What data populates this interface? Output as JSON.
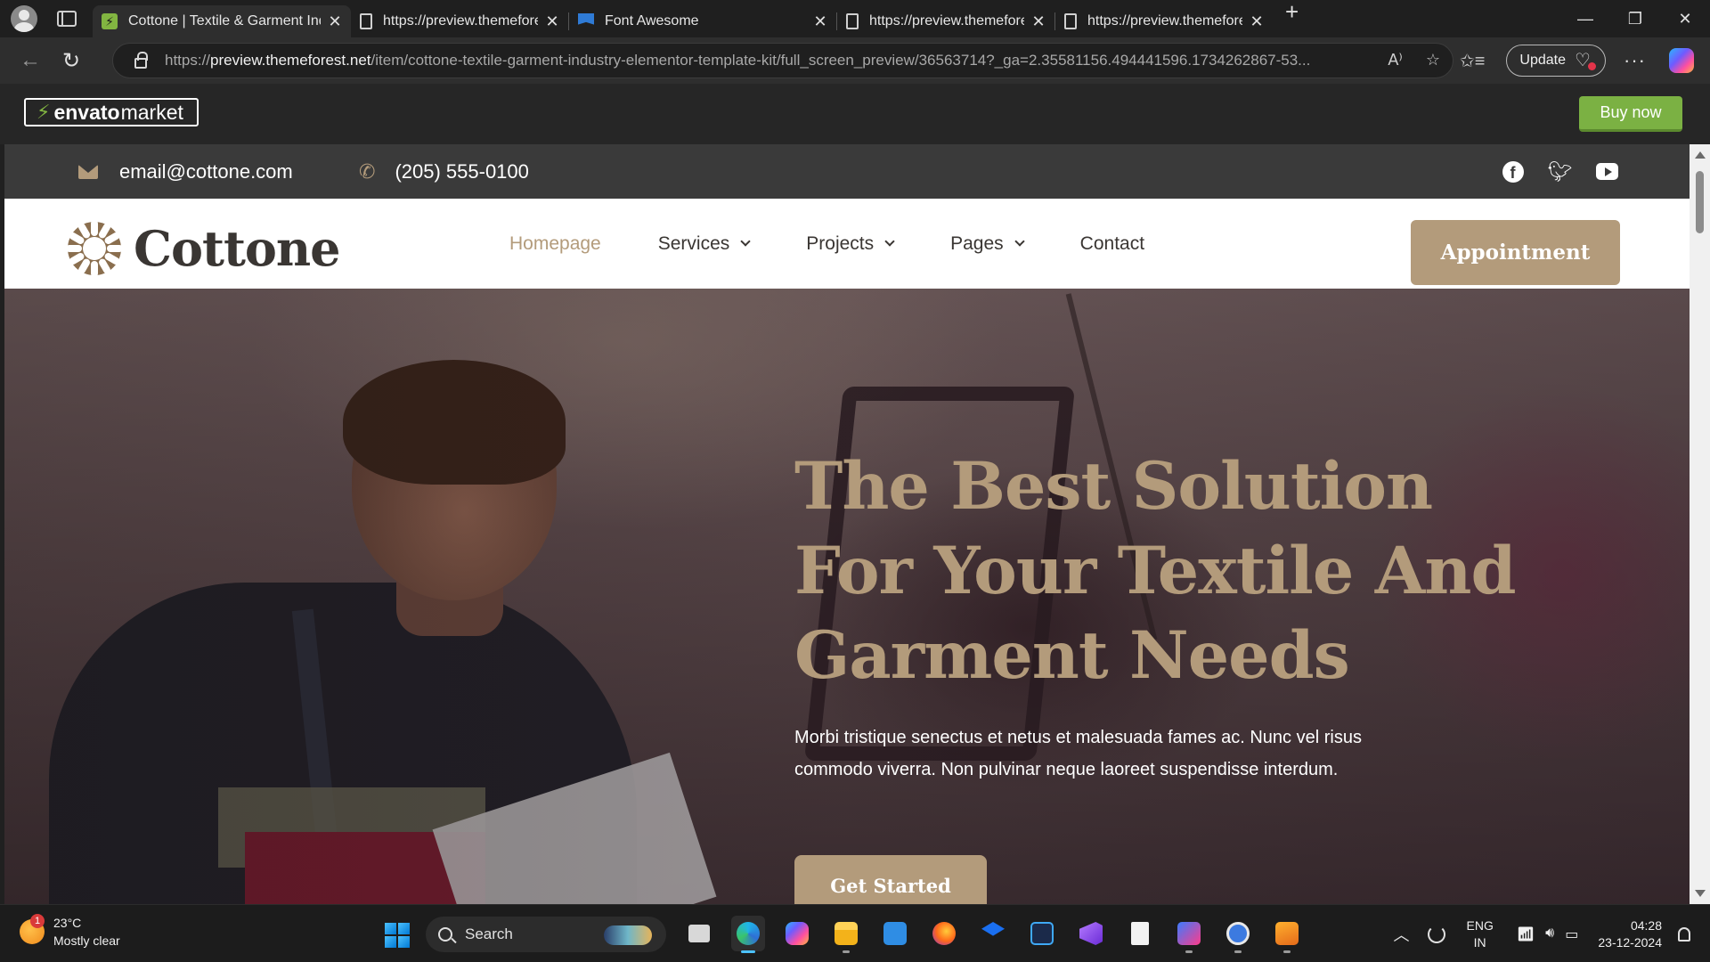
{
  "browser": {
    "tabs": [
      {
        "title": "Cottone | Textile & Garment Indus",
        "favicon": "envato-icon",
        "active": true
      },
      {
        "title": "https://preview.themeforest.net/it",
        "favicon": "page-icon",
        "active": false
      },
      {
        "title": "Font Awesome",
        "favicon": "font-awesome-icon",
        "active": false
      },
      {
        "title": "https://preview.themeforest.net/it",
        "favicon": "page-icon",
        "active": false
      },
      {
        "title": "https://preview.themeforest.net/it",
        "favicon": "page-icon",
        "active": false
      }
    ],
    "tab_close": "✕",
    "new_tab": "+",
    "window": {
      "minimize": "—",
      "restore": "❐",
      "close": "✕"
    },
    "url": {
      "scheme": "https://",
      "host": "preview.themeforest.net",
      "path": "/item/cottone-textile-garment-industry-elementor-template-kit/full_screen_preview/36563714?_ga=2.35581156.494441596.1734262867-53..."
    },
    "read_aloud": "A⁾",
    "favorite_star": "☆",
    "favorites": "✩≡",
    "update_label": "Update",
    "more": "···"
  },
  "envato": {
    "logo_bold": "envato",
    "logo_light": "market",
    "buy_now": "Buy now",
    "accent": "#7bb143"
  },
  "site": {
    "topbar": {
      "email": "email@cottone.com",
      "phone": "(205) 555-0100",
      "socials": [
        "facebook-icon",
        "twitter-icon",
        "youtube-icon"
      ]
    },
    "brand": "Cottone",
    "nav": [
      {
        "label": "Homepage",
        "active": true,
        "dropdown": false
      },
      {
        "label": "Services",
        "active": false,
        "dropdown": true
      },
      {
        "label": "Projects",
        "active": false,
        "dropdown": true
      },
      {
        "label": "Pages",
        "active": false,
        "dropdown": true
      },
      {
        "label": "Contact",
        "active": false,
        "dropdown": false
      }
    ],
    "cta": "Appointment",
    "accent": "#b39b7b",
    "hero": {
      "title_line1": "The Best Solution",
      "title_line2": "For Your Textile And",
      "title_line3": "Garment Needs",
      "body": "Morbi tristique senectus et netus et malesuada fames ac. Nunc vel risus commodo viverra. Non pulvinar neque laoreet suspendisse interdum.",
      "button": "Get Started"
    }
  },
  "taskbar": {
    "weather": {
      "temp": "23°C",
      "desc": "Mostly clear",
      "badge": "1"
    },
    "search_label": "Search",
    "apps": [
      "task-view-icon",
      "edge-icon",
      "copilot-icon",
      "file-explorer-icon",
      "mail-icon",
      "firefox-icon",
      "dropbox-icon",
      "app-icon",
      "visual-studio-icon",
      "notepad-icon",
      "jetbrains-icon",
      "android-studio-icon",
      "sublime-text-icon"
    ],
    "lang_line1": "ENG",
    "lang_line2": "IN",
    "time": "04:28",
    "date": "23-12-2024"
  }
}
